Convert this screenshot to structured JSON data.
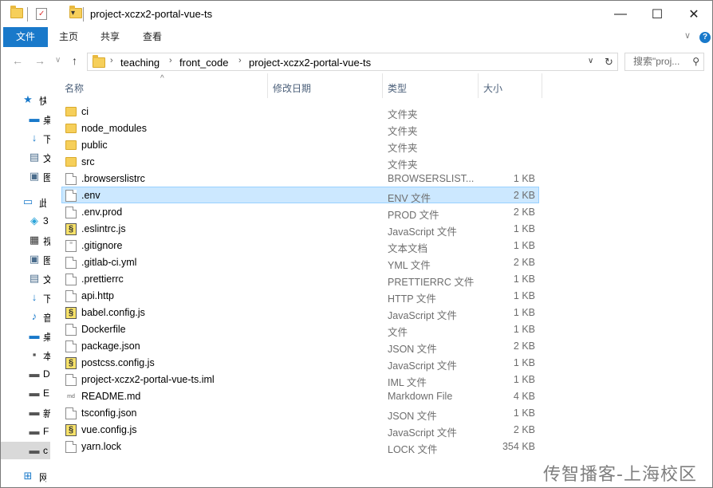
{
  "window": {
    "title": "project-xczx2-portal-vue-ts",
    "minimize_glyph": "—",
    "maximize_glyph": "☐",
    "close_glyph": "✕"
  },
  "ribbon": {
    "tabs": [
      {
        "label": "文件",
        "active": true
      },
      {
        "label": "主页",
        "active": false
      },
      {
        "label": "共享",
        "active": false
      },
      {
        "label": "查看",
        "active": false
      }
    ],
    "collapse_glyph": "∨",
    "help_glyph": "?"
  },
  "address": {
    "back_glyph": "←",
    "forward_glyph": "→",
    "recent_glyph": "∨",
    "up_glyph": "↑",
    "crumbs": [
      "teaching",
      "front_code",
      "project-xczx2-portal-vue-ts"
    ],
    "crumb_separator": "›",
    "dropdown_glyph": "∨",
    "refresh_glyph": "↻",
    "search_placeholder": "搜索\"proj...",
    "search_glyph": "⚲"
  },
  "navpane": {
    "items": [
      {
        "label": "快",
        "icon": "star-icon",
        "glyph": "★"
      },
      {
        "label": "桌",
        "icon": "desktop-icon",
        "glyph": "▬"
      },
      {
        "label": "下",
        "icon": "download-icon",
        "glyph": "↓"
      },
      {
        "label": "文",
        "icon": "document-icon",
        "glyph": "▤"
      },
      {
        "label": "图",
        "icon": "picture-icon",
        "glyph": "▣"
      },
      {
        "label": "此",
        "icon": "computer-icon",
        "glyph": "▭"
      },
      {
        "label": "3",
        "icon": "cube-icon",
        "glyph": "◈"
      },
      {
        "label": "视",
        "icon": "video-icon",
        "glyph": "▦"
      },
      {
        "label": "图",
        "icon": "picture-icon",
        "glyph": "▣"
      },
      {
        "label": "文",
        "icon": "document-icon",
        "glyph": "▤"
      },
      {
        "label": "下",
        "icon": "download-icon",
        "glyph": "↓"
      },
      {
        "label": "音",
        "icon": "music-icon",
        "glyph": "♪"
      },
      {
        "label": "桌",
        "icon": "desktop-icon",
        "glyph": "▬"
      },
      {
        "label": "本",
        "icon": "drive-icon",
        "glyph": "▪"
      },
      {
        "label": "D",
        "icon": "drive-icon",
        "glyph": "▬"
      },
      {
        "label": "E",
        "icon": "drive-icon",
        "glyph": "▬"
      },
      {
        "label": "新",
        "icon": "drive-icon",
        "glyph": "▬"
      },
      {
        "label": "F",
        "icon": "drive-icon",
        "glyph": "▬"
      },
      {
        "label": "c",
        "icon": "drive-icon",
        "glyph": "▬"
      },
      {
        "label": "网",
        "icon": "network-icon",
        "glyph": "⊞"
      }
    ]
  },
  "columns": {
    "name": "名称",
    "modified": "修改日期",
    "type": "类型",
    "size": "大小",
    "sort_glyph": "^"
  },
  "files": [
    {
      "name": "ci",
      "type": "文件夹",
      "size": "",
      "icon": "folder"
    },
    {
      "name": "node_modules",
      "type": "文件夹",
      "size": "",
      "icon": "folder"
    },
    {
      "name": "public",
      "type": "文件夹",
      "size": "",
      "icon": "folder"
    },
    {
      "name": "src",
      "type": "文件夹",
      "size": "",
      "icon": "folder"
    },
    {
      "name": ".browserslistrc",
      "type": "BROWSERSLIST...",
      "size": "1 KB",
      "icon": "doc"
    },
    {
      "name": ".env",
      "type": "ENV 文件",
      "size": "2 KB",
      "icon": "doc",
      "selected": true
    },
    {
      "name": ".env.prod",
      "type": "PROD 文件",
      "size": "2 KB",
      "icon": "doc"
    },
    {
      "name": ".eslintrc.js",
      "type": "JavaScript 文件",
      "size": "1 KB",
      "icon": "js"
    },
    {
      "name": ".gitignore",
      "type": "文本文档",
      "size": "1 KB",
      "icon": "txt"
    },
    {
      "name": ".gitlab-ci.yml",
      "type": "YML 文件",
      "size": "2 KB",
      "icon": "doc"
    },
    {
      "name": ".prettierrc",
      "type": "PRETTIERRC 文件",
      "size": "1 KB",
      "icon": "doc"
    },
    {
      "name": "api.http",
      "type": "HTTP 文件",
      "size": "1 KB",
      "icon": "doc"
    },
    {
      "name": "babel.config.js",
      "type": "JavaScript 文件",
      "size": "1 KB",
      "icon": "js"
    },
    {
      "name": "Dockerfile",
      "type": "文件",
      "size": "1 KB",
      "icon": "doc"
    },
    {
      "name": "package.json",
      "type": "JSON 文件",
      "size": "2 KB",
      "icon": "doc"
    },
    {
      "name": "postcss.config.js",
      "type": "JavaScript 文件",
      "size": "1 KB",
      "icon": "js"
    },
    {
      "name": "project-xczx2-portal-vue-ts.iml",
      "type": "IML 文件",
      "size": "1 KB",
      "icon": "doc"
    },
    {
      "name": "README.md",
      "type": "Markdown File",
      "size": "4 KB",
      "icon": "md"
    },
    {
      "name": "tsconfig.json",
      "type": "JSON 文件",
      "size": "1 KB",
      "icon": "doc"
    },
    {
      "name": "vue.config.js",
      "type": "JavaScript 文件",
      "size": "2 KB",
      "icon": "js"
    },
    {
      "name": "yarn.lock",
      "type": "LOCK 文件",
      "size": "354 KB",
      "icon": "doc"
    }
  ],
  "icon_glyphs": {
    "js": "§",
    "txt": "≡",
    "md": "md"
  },
  "watermark": "传智播客-上海校区"
}
